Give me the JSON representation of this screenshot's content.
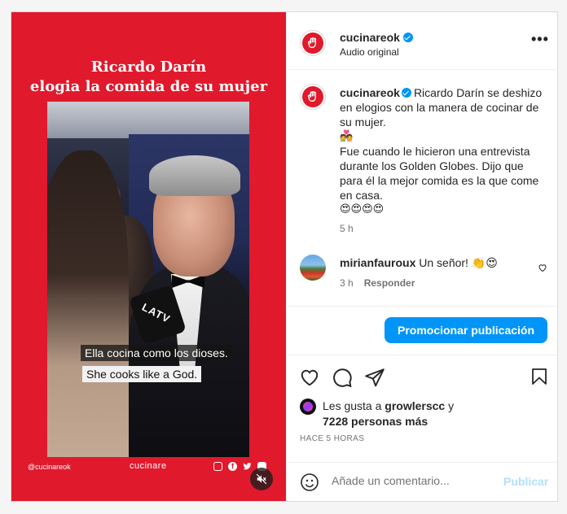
{
  "media": {
    "headline_line1": "Ricardo Darín",
    "headline_line2": "elogia la comida de su mujer",
    "mic_label": "LATV",
    "subtitle_es": "Ella cocina como los dioses.",
    "subtitle_en": "She cooks like a God.",
    "footer_handle": "@cucinareok",
    "footer_brand": "cucinare",
    "social_icons": [
      "instagram-icon",
      "facebook-icon",
      "twitter-icon",
      "youtube-icon"
    ],
    "mute_icon": "speaker-muted-icon"
  },
  "header": {
    "username": "cucinareok",
    "subtitle": "Audio original",
    "verified": true,
    "more_icon": "more-options-icon",
    "more_label": "•••"
  },
  "caption": {
    "username": "cucinareok",
    "text": "Ricardo Darín se deshizo en elogios con la manera de cocinar de su mujer.",
    "emoji_line": "💑",
    "text2": "Fue cuando le hicieron una entrevista durante los Golden Globes. Dijo que para él la mejor comida es la que come en casa.",
    "emoji_line2": "😍😍😍😍",
    "time": "5 h"
  },
  "comments": [
    {
      "username": "mirianfauroux",
      "text": "Un señor! 👏😍",
      "time": "3 h",
      "reply_label": "Responder"
    }
  ],
  "promote": {
    "label": "Promocionar publicación"
  },
  "actions": {
    "like_icon": "heart-icon",
    "comment_icon": "comment-icon",
    "share_icon": "share-icon",
    "save_icon": "bookmark-icon"
  },
  "likes": {
    "prefix": "Les gusta a",
    "user": "growlerscc",
    "suffix": "y",
    "others": "7228 personas más"
  },
  "post_time": "HACE 5 HORAS",
  "comment_box": {
    "placeholder": "Añade un comentario...",
    "post_label": "Publicar"
  },
  "colors": {
    "brand_red": "#e1192c",
    "accent_blue": "#0095f6",
    "post_disabled": "#b2dffc"
  }
}
